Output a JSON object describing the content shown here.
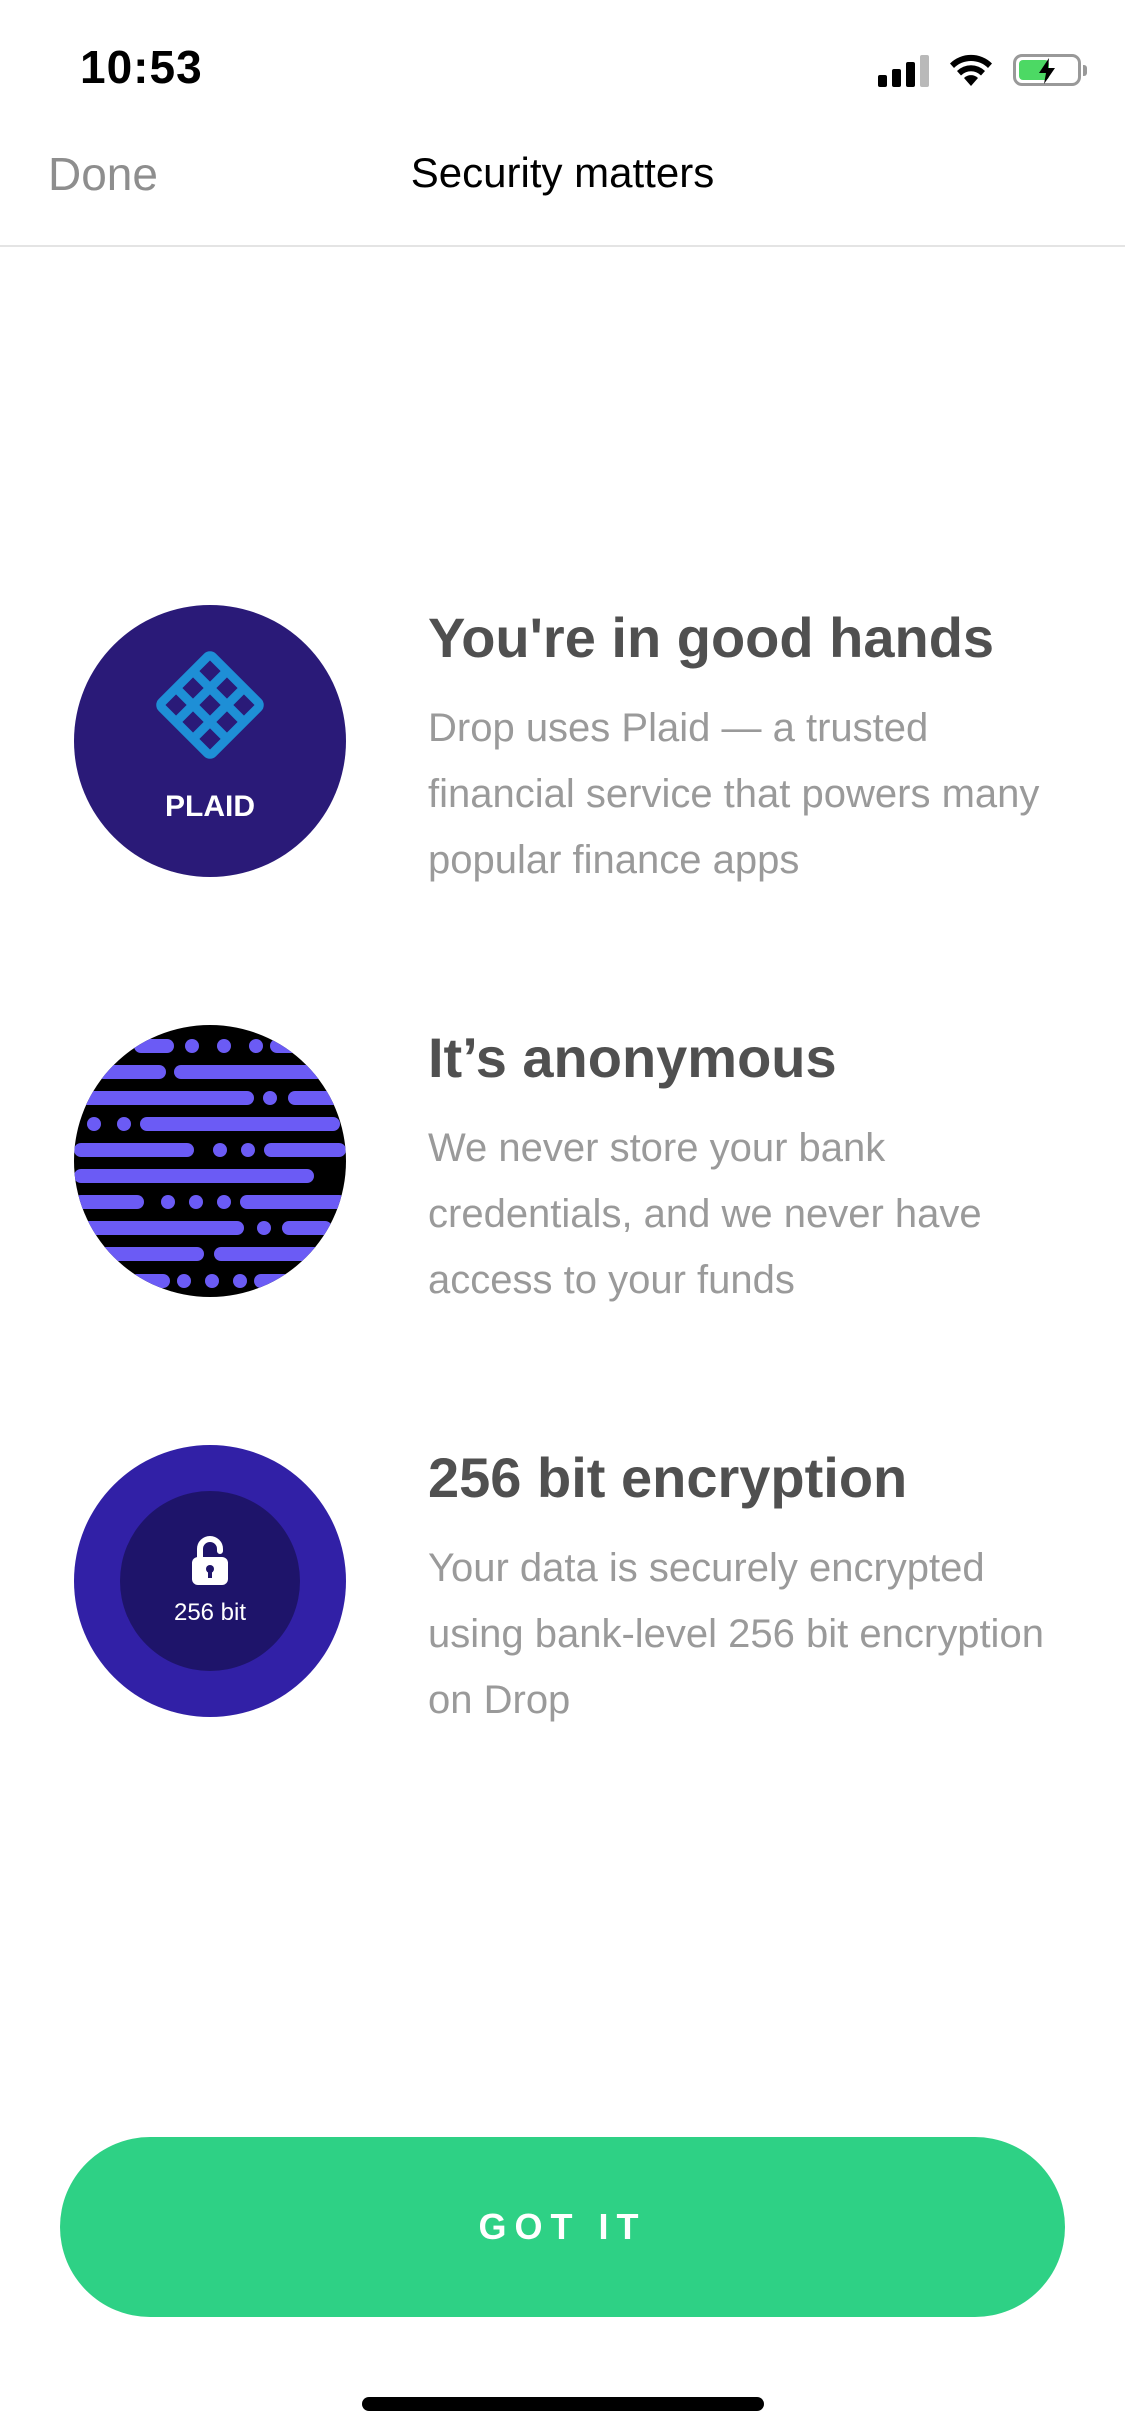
{
  "status_bar": {
    "time": "10:53",
    "icons": [
      "signal-icon",
      "wifi-icon",
      "battery-charging-icon"
    ]
  },
  "nav": {
    "done_label": "Done",
    "title": "Security matters"
  },
  "features": [
    {
      "title": "You're in good hands",
      "description": "Drop uses Plaid — a trusted financial service that powers many popular finance apps",
      "icon": "plaid-logo-icon",
      "icon_text": "PLAID"
    },
    {
      "title": "It’s anonymous",
      "description": "We never store your bank credentials, and we never have access to your funds",
      "icon": "anonymous-pattern-icon"
    },
    {
      "title": "256 bit encryption",
      "description": "Your data is securely encrypted using bank-level 256 bit encryption on Drop",
      "icon": "lock-icon",
      "icon_text": "256 bit"
    }
  ],
  "button": {
    "label": "GOT IT"
  },
  "colors": {
    "accent": "#2ed185",
    "plaid_blue": "#2a1a78",
    "encryption_purple": "#3120a6",
    "pattern_purple": "#6b5bf5"
  }
}
